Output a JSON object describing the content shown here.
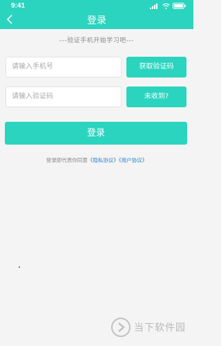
{
  "status_bar": {
    "time": "9:41"
  },
  "header": {
    "title": "登录"
  },
  "hint": "---验证手机开始学习吧---",
  "form": {
    "phone_placeholder": "请输入手机号",
    "code_placeholder": "请输入验证码",
    "get_code_label": "获取验证码",
    "not_received_label": "未收到?",
    "login_label": "登录"
  },
  "agreement": {
    "prefix": "登录即代表你同意",
    "privacy": "《隐私协议》",
    "user": "《用户协议》"
  },
  "watermark": {
    "text": "当下软件园"
  },
  "colors": {
    "accent": "#2bd4bf",
    "link": "#2a86c9"
  }
}
